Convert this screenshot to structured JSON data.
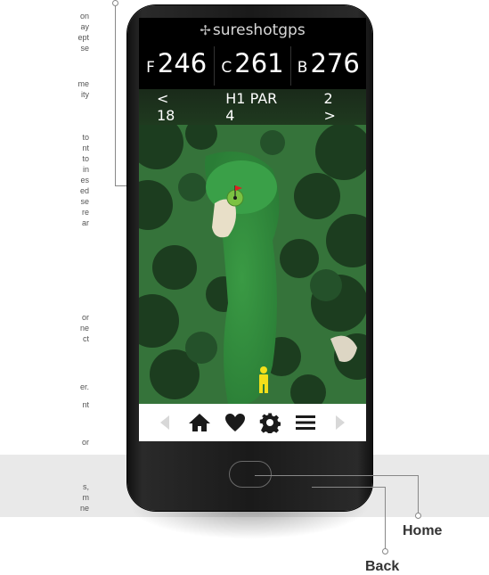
{
  "doc_text": {
    "block1": [
      "on",
      "ay",
      "ept",
      "se"
    ],
    "block2": [
      "me",
      "ity"
    ],
    "block3": [
      "to",
      "nt",
      "to",
      "in",
      "es",
      "ed",
      "se",
      "re",
      "ar"
    ],
    "block4": [
      "or",
      "ne",
      "ct"
    ],
    "block5": [
      "er.",
      "nt"
    ],
    "block6": [
      "or"
    ],
    "block7": [
      "s,",
      "m",
      "ne"
    ]
  },
  "app": {
    "brand": "sureshotgps",
    "front": {
      "label": "F",
      "value": "246"
    },
    "center": {
      "label": "C",
      "value": "261"
    },
    "back": {
      "label": "B",
      "value": "276"
    },
    "hole_prev": "< 18",
    "hole_info": "H1 PAR 4",
    "hole_next": "2 >"
  },
  "tabs": [
    "prev-arrow-icon",
    "home-icon",
    "heart-icon",
    "gear-icon",
    "menu-icon",
    "next-arrow-icon"
  ],
  "callouts": {
    "home": "Home",
    "back": "Back"
  },
  "colors": {
    "fairway": "#2d8a3a",
    "flag": "#e02020",
    "player": "#f3df1a",
    "green": "#7cc242"
  }
}
